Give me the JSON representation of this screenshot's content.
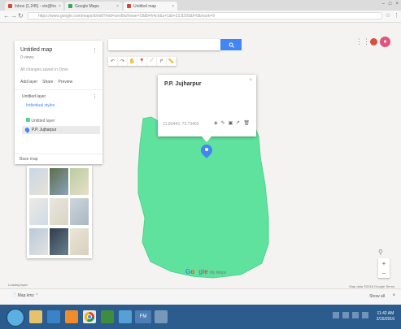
{
  "browser": {
    "tabs": [
      {
        "label": "Inbox (1,245) - vin@ho",
        "color": "#d44638"
      },
      {
        "label": "Google Maps",
        "color": "#34a853"
      },
      {
        "label": "Untitled map",
        "color": "#d44638"
      }
    ],
    "url": "https://www.google.com/maps/d/edit?mid=zevBw/hvwe=18&ll=h4ch&z=1&t=23.8293&l=0&mark=9"
  },
  "panel": {
    "title": "Untitled map",
    "subtitle": "0 views",
    "saved": "All changes saved in Drive",
    "actions": [
      "Add layer",
      "Share",
      "Preview"
    ],
    "layer": {
      "title": "Untitled layer",
      "style": "Individual styles",
      "items": [
        "Untitled layer",
        "P.P. Jujharpur"
      ]
    },
    "basemap_label": "Base map"
  },
  "map": {
    "info_title": "P.P. Jujharpur",
    "info_coords": "21.83443, 73.73403",
    "logo": "Google My Maps",
    "status_left": "Loading layer",
    "status_right": "Map data ©2016 Google  Terms",
    "colors": {
      "polygon": "#5ee29e",
      "primary": "#4285f4"
    }
  },
  "downloads": {
    "item": "Map.kmz",
    "show_all": "Show all"
  },
  "taskbar": {
    "app_label": "FM",
    "time": "11:42 AM",
    "date": "2/16/2016"
  }
}
